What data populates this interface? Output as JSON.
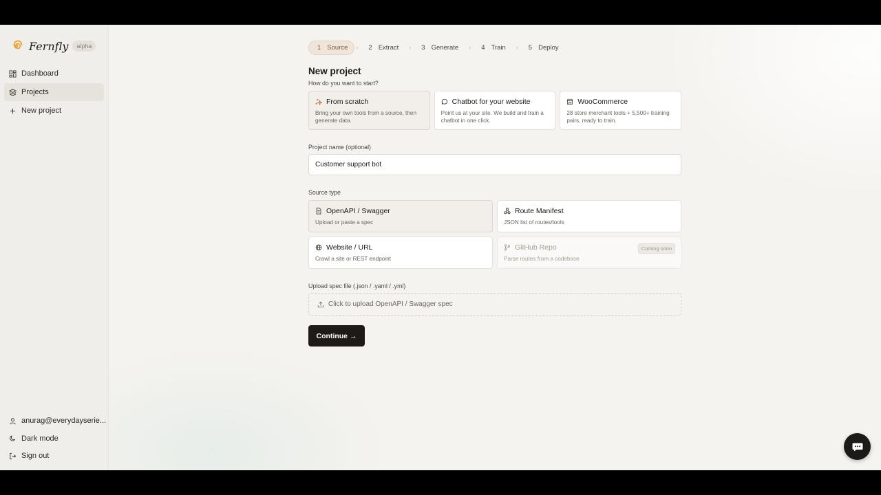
{
  "brand": {
    "name": "Fernfly",
    "badge": "alpha"
  },
  "sidebar": {
    "items": [
      {
        "label": "Dashboard",
        "icon": "dashboard-icon"
      },
      {
        "label": "Projects",
        "icon": "layers-icon"
      },
      {
        "label": "New project",
        "icon": "plus-icon"
      }
    ],
    "bottom": [
      {
        "label": "anurag@everydayserie...",
        "icon": "user-icon"
      },
      {
        "label": "Dark mode",
        "icon": "moon-icon"
      },
      {
        "label": "Sign out",
        "icon": "logout-icon"
      }
    ]
  },
  "stepper": {
    "steps": [
      {
        "num": "1",
        "label": "Source"
      },
      {
        "num": "2",
        "label": "Extract"
      },
      {
        "num": "3",
        "label": "Generate"
      },
      {
        "num": "4",
        "label": "Train"
      },
      {
        "num": "5",
        "label": "Deploy"
      }
    ],
    "active": "1"
  },
  "page": {
    "title": "New project",
    "start_question": "How do you want to start?"
  },
  "starters": [
    {
      "title": "From scratch",
      "desc": "Bring your own tools from a source, then generate data.",
      "icon": "sparkle-icon"
    },
    {
      "title": "Chatbot for your website",
      "desc": "Point us at your site. We build and train a chatbot in one click.",
      "icon": "chat-bubble-icon"
    },
    {
      "title": "WooCommerce",
      "desc": "28 store merchant tools + 5,500+ training pairs, ready to train.",
      "icon": "store-icon"
    }
  ],
  "project_name": {
    "label": "Project name",
    "optional": "(optional)",
    "value": "Customer support bot"
  },
  "source_type": {
    "label": "Source type",
    "options": [
      {
        "title": "OpenAPI / Swagger",
        "desc": "Upload or paste a spec",
        "icon": "file-icon"
      },
      {
        "title": "Route Manifest",
        "desc": "JSON list of routes/tools",
        "icon": "network-icon"
      },
      {
        "title": "Website / URL",
        "desc": "Crawl a site or REST endpoint",
        "icon": "globe-icon"
      },
      {
        "title": "GitHub Repo",
        "desc": "Parse routes from a codebase",
        "icon": "git-branch-icon",
        "badge": "Coming soon"
      }
    ]
  },
  "upload": {
    "label": "Upload spec file (.json / .yaml / .yml)",
    "cta": "Click to upload OpenAPI / Swagger spec"
  },
  "continue_label": "Continue →"
}
